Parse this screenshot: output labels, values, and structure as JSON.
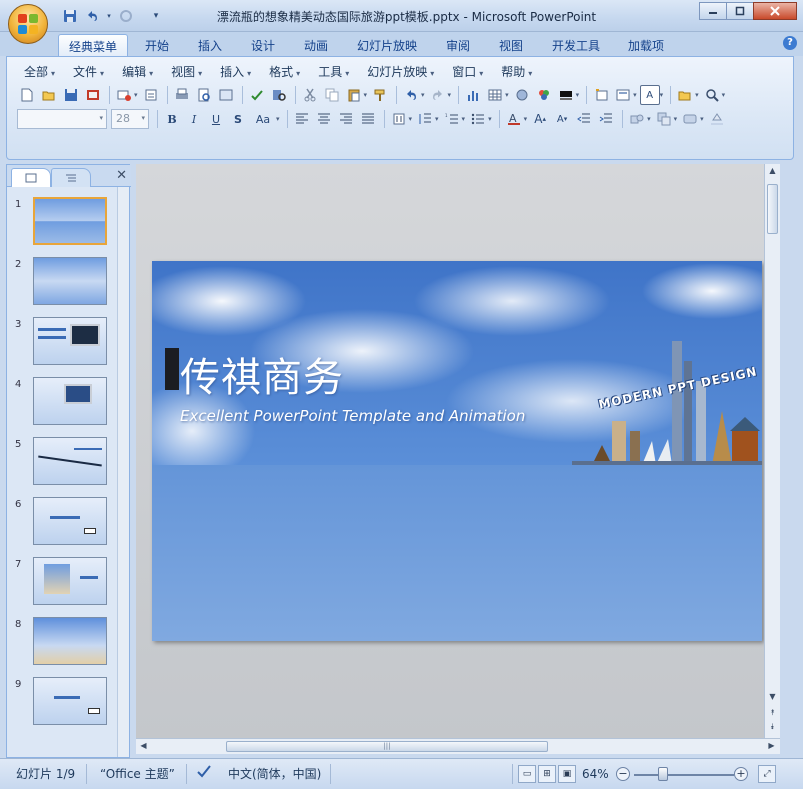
{
  "window": {
    "title": "漂流瓶的想象精美动态国际旅游ppt模板.pptx - Microsoft PowerPoint"
  },
  "ribbon_tabs": [
    {
      "label": "经典菜单",
      "active": true
    },
    {
      "label": "开始"
    },
    {
      "label": "插入"
    },
    {
      "label": "设计"
    },
    {
      "label": "动画"
    },
    {
      "label": "幻灯片放映"
    },
    {
      "label": "审阅"
    },
    {
      "label": "视图"
    },
    {
      "label": "开发工具"
    },
    {
      "label": "加载项"
    }
  ],
  "classic_menu": [
    {
      "label": "全部"
    },
    {
      "label": "文件"
    },
    {
      "label": "编辑"
    },
    {
      "label": "视图"
    },
    {
      "label": "插入"
    },
    {
      "label": "格式"
    },
    {
      "label": "工具"
    },
    {
      "label": "幻灯片放映"
    },
    {
      "label": "窗口"
    },
    {
      "label": "帮助"
    }
  ],
  "format_bar": {
    "font_name": "",
    "font_size": "28"
  },
  "slides_pane": {
    "slide_numbers": [
      "1",
      "2",
      "3",
      "4",
      "5",
      "6",
      "7",
      "8",
      "9"
    ],
    "selected": "1"
  },
  "slide": {
    "title": "传祺商务",
    "subtitle": "Excellent PowerPoint Template and Animation",
    "badge": "MODERN PPT DESIGN"
  },
  "statusbar": {
    "slide_info": "幻灯片 1/9",
    "theme": "“Office 主题”",
    "language": "中文(简体，中国)",
    "zoom": "64%"
  },
  "colors": {
    "ribbon_bg": "#dbe7f6",
    "accent": "#15428b",
    "slide_blue": "#4d80cf"
  }
}
